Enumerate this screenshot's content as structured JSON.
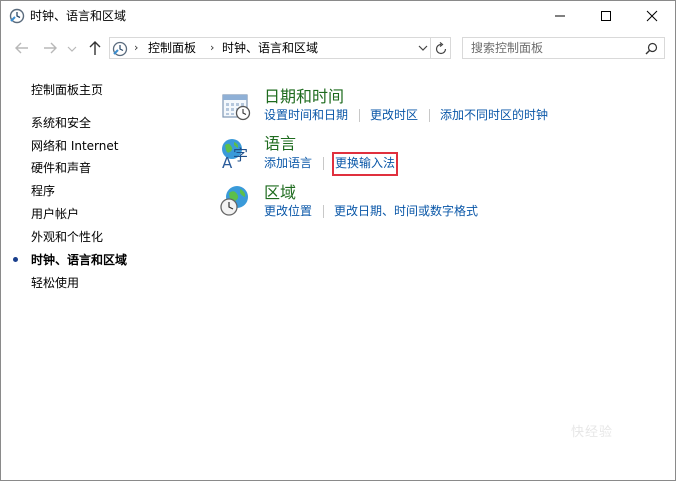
{
  "window": {
    "title": "时钟、语言和区域"
  },
  "address": {
    "crumbs": [
      "控制面板",
      "时钟、语言和区域"
    ]
  },
  "search": {
    "placeholder": "搜索控制面板"
  },
  "sidebar": {
    "home": "控制面板主页",
    "items": [
      {
        "label": "系统和安全"
      },
      {
        "label": "网络和 Internet"
      },
      {
        "label": "硬件和声音"
      },
      {
        "label": "程序"
      },
      {
        "label": "用户帐户"
      },
      {
        "label": "外观和个性化"
      },
      {
        "label": "时钟、语言和区域",
        "current": true
      },
      {
        "label": "轻松使用"
      }
    ]
  },
  "categories": [
    {
      "title": "日期和时间",
      "icon": "calendar-clock-icon",
      "links": [
        "设置时间和日期",
        "更改时区",
        "添加不同时区的时钟"
      ]
    },
    {
      "title": "语言",
      "icon": "language-globe-icon",
      "links": [
        "添加语言",
        "更换输入法"
      ]
    },
    {
      "title": "区域",
      "icon": "region-globe-clock-icon",
      "links": [
        "更改位置",
        "更改日期、时间或数字格式"
      ]
    }
  ],
  "highlight": {
    "target": "更换输入法",
    "color": "#e0303e"
  },
  "watermark": "快经验",
  "colors": {
    "link": "#0a57a8",
    "category_title": "#1e6b1e",
    "highlight": "#e0303e"
  }
}
